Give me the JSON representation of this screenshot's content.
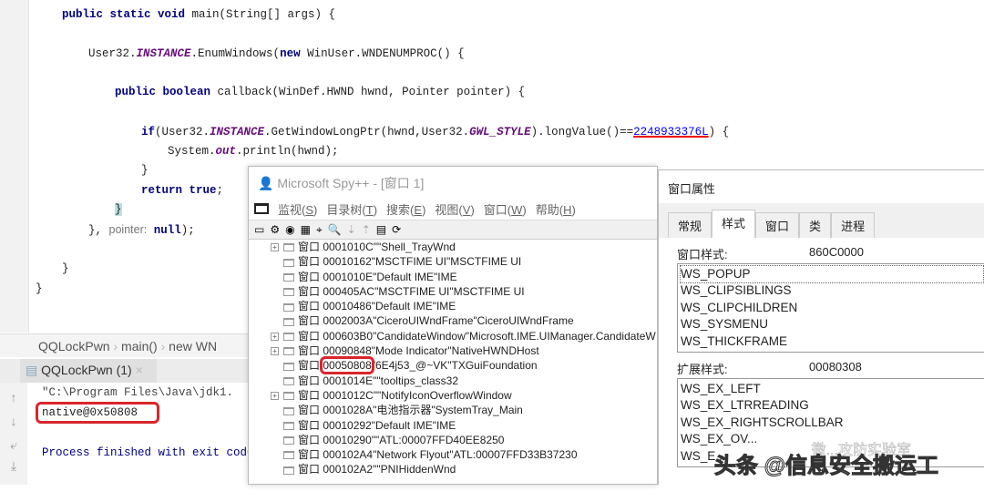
{
  "code": {
    "l1": [
      "public static void",
      " main(String[] args) {"
    ],
    "l2": [
      "User32.",
      "INSTANCE",
      ".EnumWindows(",
      "new",
      " WinUser.WNDENUMPROC() {"
    ],
    "l3": [
      "public boolean",
      " callback(WinDef.HWND hwnd, Pointer pointer) {"
    ],
    "l4": [
      "if",
      "(User32.",
      "INSTANCE",
      ".GetWindowLongPtr(hwnd,User32.",
      "GWL_STYLE",
      ").longValue()==",
      "2248933376L",
      ") {"
    ],
    "l5": [
      "System.",
      "out",
      ".println(hwnd);"
    ],
    "l6": "}",
    "l7": [
      "return true",
      ";"
    ],
    "l8": "}",
    "l9": [
      "}, ",
      "pointer:",
      " null",
      ");"
    ],
    "l10": "}",
    "l11": "}"
  },
  "breadcrumb": [
    "QQLockPwn",
    "main()",
    "new WN"
  ],
  "run": {
    "tab": "QQLockPwn (1)",
    "lines": [
      "\"C:\\Program Files\\Java\\jdk1.",
      "native@0x50808",
      "Process finished with exit code"
    ]
  },
  "spy": {
    "title": "Microsoft Spy++ - [窗口 1]",
    "menu": [
      [
        "监视",
        "S"
      ],
      [
        "目录树",
        "T"
      ],
      [
        "搜索",
        "E"
      ],
      [
        "视图",
        "V"
      ],
      [
        "窗口",
        "W"
      ],
      [
        "帮助",
        "H"
      ]
    ],
    "rows": [
      {
        "exp": true,
        "w": "窗口",
        "h": "0001010C",
        "t": "\"\"Shell_TrayWnd"
      },
      {
        "exp": false,
        "w": "窗口",
        "h": "00010162",
        "t": "\"MSCTFIME UI\"MSCTFIME UI"
      },
      {
        "exp": false,
        "w": "窗口",
        "h": "0001010E",
        "t": "\"Default IME\"IME"
      },
      {
        "exp": false,
        "w": "窗口",
        "h": "000405AC",
        "t": "\"MSCTFIME UI\"MSCTFIME UI"
      },
      {
        "exp": false,
        "w": "窗口",
        "h": "00010486",
        "t": "\"Default IME\"IME"
      },
      {
        "exp": false,
        "w": "窗口",
        "h": "0002003A",
        "t": "\"CiceroUIWndFrame\"CiceroUIWndFrame"
      },
      {
        "exp": true,
        "w": "窗口",
        "h": "000603B0",
        "t": "\"CandidateWindow\"Microsoft.IME.UIManager.CandidateW"
      },
      {
        "exp": true,
        "w": "窗口",
        "h": "00090848",
        "t": "\"Mode Indicator\"NativeHWNDHost"
      },
      {
        "exp": false,
        "w": "窗口",
        "h": "00050808",
        "t": "\"6E4j53_@~VK\"TXGuiFoundation",
        "hl": true
      },
      {
        "exp": false,
        "w": "窗口",
        "h": "0001014E",
        "t": "\"\"tooltips_class32"
      },
      {
        "exp": true,
        "w": "窗口",
        "h": "0001012C",
        "t": "\"\"NotifyIconOverflowWindow"
      },
      {
        "exp": false,
        "w": "窗口",
        "h": "0001028A",
        "t": "\"电池指示器\"SystemTray_Main"
      },
      {
        "exp": false,
        "w": "窗口",
        "h": "00010292",
        "t": "\"Default IME\"IME"
      },
      {
        "exp": false,
        "w": "窗口",
        "h": "00010290",
        "t": "\"\"ATL:00007FFD40EE8250"
      },
      {
        "exp": false,
        "w": "窗口",
        "h": "000102A4",
        "t": "\"Network Flyout\"ATL:00007FFD33B37230"
      },
      {
        "exp": false,
        "w": "窗口",
        "h": "000102A2",
        "t": "\"\"PNIHiddenWnd"
      }
    ]
  },
  "props": {
    "title": "窗口属性",
    "tabs": [
      "常规",
      "样式",
      "窗口",
      "类",
      "进程"
    ],
    "style_label": "窗口样式:",
    "style_value": "860C0000",
    "styles": [
      "WS_POPUP",
      "WS_CLIPSIBLINGS",
      "WS_CLIPCHILDREN",
      "WS_SYSMENU",
      "WS_THICKFRAME"
    ],
    "ex_label": "扩展样式:",
    "ex_value": "00080308",
    "ex_styles": [
      "WS_EX_LEFT",
      "WS_EX_LTRREADING",
      "WS_EX_RIGHTSCROLLBAR",
      "WS_EX_OV...",
      "WS_E..."
    ]
  },
  "watermark": {
    "main": "头条 @信息安全搬运工",
    "sub": "微...攻防实验室"
  }
}
